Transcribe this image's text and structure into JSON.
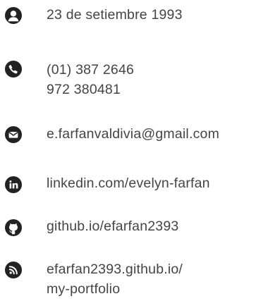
{
  "contact": {
    "birthday": {
      "icon": "user-icon",
      "lines": [
        "23 de setiembre 1993"
      ]
    },
    "phone": {
      "icon": "phone-icon",
      "lines": [
        "(01) 387 2646",
        "972 380481"
      ]
    },
    "email": {
      "icon": "envelope-icon",
      "lines": [
        "e.farfanvaldivia@gmail.com"
      ]
    },
    "linkedin": {
      "icon": "linkedin-icon",
      "lines": [
        "linkedin.com/evelyn-farfan"
      ]
    },
    "github": {
      "icon": "github-icon",
      "lines": [
        "github.io/efarfan2393"
      ]
    },
    "portfolio": {
      "icon": "rss-icon",
      "lines": [
        "efarfan2393.github.io/",
        "my-portfolio"
      ]
    }
  },
  "colors": {
    "icon_background": "#222222",
    "icon_foreground": "#ffffff",
    "text": "#444444"
  }
}
